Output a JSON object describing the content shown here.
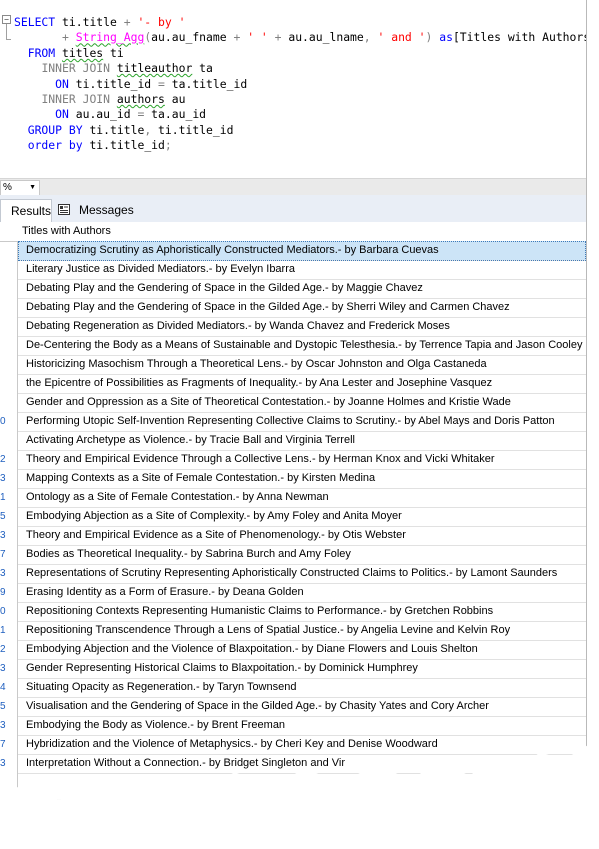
{
  "editor": {
    "lines": [
      {
        "parts": [
          {
            "c": "kw",
            "t": "SELECT"
          },
          {
            "c": "",
            "t": " ti.title "
          },
          {
            "c": "gr",
            "t": "+"
          },
          {
            "c": "",
            "t": " "
          },
          {
            "c": "st",
            "t": "'- by '"
          }
        ]
      },
      {
        "parts": [
          {
            "c": "",
            "t": "       "
          },
          {
            "c": "gr",
            "t": "+"
          },
          {
            "c": "",
            "t": " "
          },
          {
            "c": "fn sq",
            "t": "String_Agg"
          },
          {
            "c": "gr",
            "t": "("
          },
          {
            "c": "",
            "t": "au.au_fname "
          },
          {
            "c": "gr",
            "t": "+"
          },
          {
            "c": "",
            "t": " "
          },
          {
            "c": "st",
            "t": "' '"
          },
          {
            "c": "",
            "t": " "
          },
          {
            "c": "gr",
            "t": "+"
          },
          {
            "c": "",
            "t": " au.au_lname"
          },
          {
            "c": "gr",
            "t": ","
          },
          {
            "c": "",
            "t": " "
          },
          {
            "c": "st",
            "t": "' and '"
          },
          {
            "c": "gr",
            "t": ")"
          },
          {
            "c": "",
            "t": " "
          },
          {
            "c": "kw",
            "t": "as"
          },
          {
            "c": "",
            "t": "[Titles with Authors]"
          }
        ]
      },
      {
        "parts": [
          {
            "c": "",
            "t": "  "
          },
          {
            "c": "kw",
            "t": "FROM"
          },
          {
            "c": "",
            "t": " "
          },
          {
            "c": "sq",
            "t": "titles"
          },
          {
            "c": "",
            "t": " ti"
          }
        ]
      },
      {
        "parts": [
          {
            "c": "",
            "t": "    "
          },
          {
            "c": "gr",
            "t": "INNER JOIN"
          },
          {
            "c": "",
            "t": " "
          },
          {
            "c": "sq",
            "t": "titleauthor"
          },
          {
            "c": "",
            "t": " ta"
          }
        ]
      },
      {
        "parts": [
          {
            "c": "",
            "t": "      "
          },
          {
            "c": "kw",
            "t": "ON"
          },
          {
            "c": "",
            "t": " ti.title_id "
          },
          {
            "c": "gr",
            "t": "="
          },
          {
            "c": "",
            "t": " ta.title_id"
          }
        ]
      },
      {
        "parts": [
          {
            "c": "",
            "t": "    "
          },
          {
            "c": "gr",
            "t": "INNER JOIN"
          },
          {
            "c": "",
            "t": " "
          },
          {
            "c": "sq",
            "t": "authors"
          },
          {
            "c": "",
            "t": " au"
          }
        ]
      },
      {
        "parts": [
          {
            "c": "",
            "t": "      "
          },
          {
            "c": "kw",
            "t": "ON"
          },
          {
            "c": "",
            "t": " au.au_id "
          },
          {
            "c": "gr",
            "t": "="
          },
          {
            "c": "",
            "t": " ta.au_id"
          }
        ]
      },
      {
        "parts": [
          {
            "c": "",
            "t": "  "
          },
          {
            "c": "kw",
            "t": "GROUP BY"
          },
          {
            "c": "",
            "t": " ti.title"
          },
          {
            "c": "gr",
            "t": ","
          },
          {
            "c": "",
            "t": " ti.title_id"
          }
        ]
      },
      {
        "parts": [
          {
            "c": "",
            "t": "  "
          },
          {
            "c": "kw",
            "t": "order by"
          },
          {
            "c": "",
            "t": " ti.title_id"
          },
          {
            "c": "gr",
            "t": ";"
          }
        ]
      }
    ]
  },
  "zoom": {
    "value": "%",
    "arrow": "▼"
  },
  "tabs": {
    "results_label": "Results",
    "messages_label": "Messages"
  },
  "grid": {
    "column_header": "Titles with Authors",
    "rows": [
      "Democratizing Scrutiny as Aphoristically Constructed Mediators.- by Barbara Cuevas",
      "Literary Justice as Divided Mediators.- by Evelyn Ibarra",
      "Debating Play and the Gendering of Space in the Gilded Age.- by Maggie Chavez",
      "Debating Play and the Gendering of Space in the Gilded Age.- by Sherri Wiley and Carmen Chavez",
      "Debating Regeneration as Divided Mediators.- by Wanda Chavez and Frederick Moses",
      "De-Centering the Body as a Means of Sustainable and Dystopic Telesthesia.- by Terrence Tapia and Jason Cooley",
      "Historicizing Masochism Through a Theoretical Lens.- by Oscar Johnston and Olga Castaneda",
      "the Epicentre of Possibilities as Fragments of Inequality.- by Ana Lester and Josephine Vasquez",
      "Gender and Oppression as a Site of Theoretical Contestation.- by Joanne Holmes and Kristie Wade",
      "Performing Utopic Self-Invention Representing Collective Claims to Scrutiny.- by Abel Mays and Doris Patton",
      "Activating Archetype as Violence.- by Tracie Ball and Virginia Terrell",
      "Theory and Empirical Evidence Through a Collective Lens.- by Herman Knox and Vicki Whitaker",
      "Mapping Contexts as a Site of Female Contestation.- by Kirsten Medina",
      "Ontology as a Site of Female Contestation.- by Anna Newman",
      "Embodying Abjection as a Site of Complexity.- by Amy Foley and Anita Moyer",
      "Theory and Empirical Evidence as a Site of Phenomenology.- by Otis Webster",
      "Bodies as Theoretical Inequality.- by Sabrina Burch and Amy Foley",
      "Representations of Scrutiny Representing Aphoristically Constructed Claims to Politics.- by Lamont Saunders",
      "Erasing Identity as a Form of Erasure.- by Deana Golden",
      "Repositioning Contexts Representing Humanistic Claims to Performance.- by Gretchen Robbins",
      "Repositioning Transcendence Through a Lens of Spatial Justice.- by Angelia Levine and Kelvin Roy",
      "Embodying Abjection and the Violence of Blaxpoitation.- by Diane Flowers and Louis Shelton",
      "Gender Representing Historical Claims to Blaxpoitation.- by Dominick Humphrey",
      "Situating Opacity as Regeneration.- by Taryn Townsend",
      "Visualisation and the Gendering of Space in the Gilded Age.- by Chasity Yates and Cory Archer",
      "Embodying the Body as Violence.- by Brent Freeman",
      "Hybridization and the Violence of Metaphysics.- by Cheri Key and Denise Woodward",
      "Interpretation Without a Connection.- by Bridget Singleton and Vir"
    ],
    "row_number_fragments": [
      "",
      "",
      "",
      "",
      "",
      "",
      "",
      "",
      "",
      "0",
      "",
      "2",
      "3",
      "1",
      "5",
      "3",
      "7",
      "3",
      "9",
      "0",
      "1",
      "2",
      "3",
      "4",
      "5",
      "3",
      "7",
      "3"
    ]
  }
}
